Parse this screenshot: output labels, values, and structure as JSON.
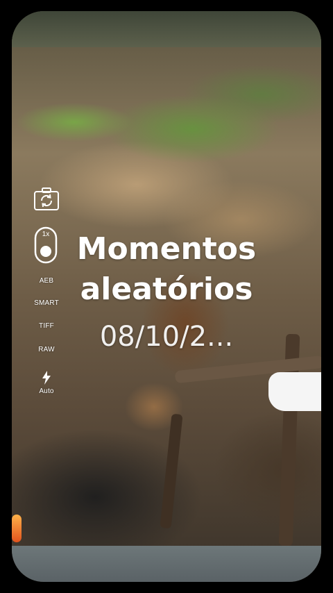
{
  "overlay": {
    "title": "Momentos aleatórios",
    "date": "08/10/2..."
  },
  "controls": {
    "switch_camera_icon": "camera-switch-icon",
    "zoom_label": "1x",
    "aeb_label": "AEB",
    "smart_label": "SMART",
    "tiff_label": "TIFF",
    "raw_label": "RAW",
    "flash_icon": "flash-icon",
    "flash_label": "Auto"
  },
  "colors": {
    "overlay_text": "#ffffff",
    "background": "#000000"
  }
}
